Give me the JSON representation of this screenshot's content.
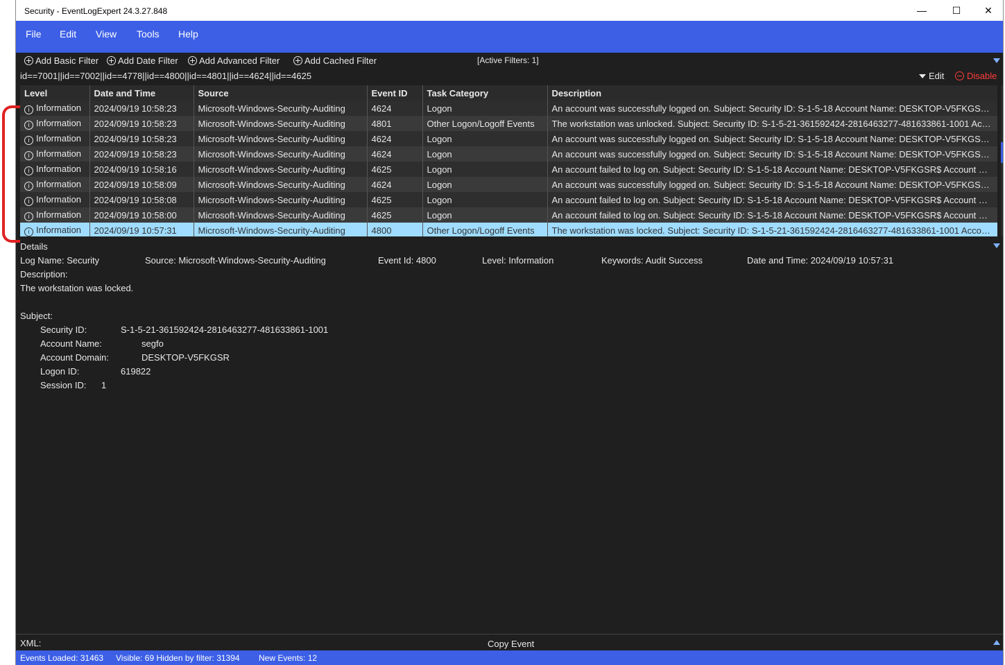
{
  "window": {
    "title": "Security - EventLogExpert 24.3.27.848"
  },
  "window_controls": {
    "minimize": "—",
    "maximize": "☐",
    "close": "✕"
  },
  "menu": [
    "File",
    "Edit",
    "View",
    "Tools",
    "Help"
  ],
  "filters": {
    "buttons": [
      "Add Basic Filter",
      "Add Date Filter",
      "Add Advanced Filter",
      "Add Cached Filter"
    ],
    "active_label": "[Active Filters: 1]",
    "expression": "id==7001||id==7002||id==4778||id==4800||id==4801||id==4624||id==4625",
    "edit_label": "Edit",
    "disable_label": "Disable"
  },
  "table": {
    "columns": [
      "Level",
      "Date and Time",
      "Source",
      "Event ID",
      "Task Category",
      "Description"
    ],
    "rows": [
      [
        "Information",
        "2024/09/19 10:58:23",
        "Microsoft-Windows-Security-Auditing",
        "4624",
        "Logon",
        "An account was successfully logged on. Subject: Security ID: S-1-5-18 Account Name: DESKTOP-V5FKGSR$ ..."
      ],
      [
        "Information",
        "2024/09/19 10:58:23",
        "Microsoft-Windows-Security-Auditing",
        "4801",
        "Other Logon/Logoff Events",
        "The workstation was unlocked. Subject: Security ID: S-1-5-21-361592424-2816463277-481633861-1001 Acc..."
      ],
      [
        "Information",
        "2024/09/19 10:58:23",
        "Microsoft-Windows-Security-Auditing",
        "4624",
        "Logon",
        "An account was successfully logged on. Subject: Security ID: S-1-5-18 Account Name: DESKTOP-V5FKGSR$ ..."
      ],
      [
        "Information",
        "2024/09/19 10:58:23",
        "Microsoft-Windows-Security-Auditing",
        "4624",
        "Logon",
        "An account was successfully logged on. Subject: Security ID: S-1-5-18 Account Name: DESKTOP-V5FKGSR$ ..."
      ],
      [
        "Information",
        "2024/09/19 10:58:16",
        "Microsoft-Windows-Security-Auditing",
        "4625",
        "Logon",
        "An account failed to log on. Subject: Security ID: S-1-5-18 Account Name: DESKTOP-V5FKGSR$ Account Do..."
      ],
      [
        "Information",
        "2024/09/19 10:58:09",
        "Microsoft-Windows-Security-Auditing",
        "4624",
        "Logon",
        "An account was successfully logged on. Subject: Security ID: S-1-5-18 Account Name: DESKTOP-V5FKGSR$ ..."
      ],
      [
        "Information",
        "2024/09/19 10:58:08",
        "Microsoft-Windows-Security-Auditing",
        "4625",
        "Logon",
        "An account failed to log on. Subject: Security ID: S-1-5-18 Account Name: DESKTOP-V5FKGSR$ Account Do..."
      ],
      [
        "Information",
        "2024/09/19 10:58:00",
        "Microsoft-Windows-Security-Auditing",
        "4625",
        "Logon",
        "An account failed to log on. Subject: Security ID: S-1-5-18 Account Name: DESKTOP-V5FKGSR$ Account Do..."
      ],
      [
        "Information",
        "2024/09/19 10:57:31",
        "Microsoft-Windows-Security-Auditing",
        "4800",
        "Other Logon/Logoff Events",
        "The workstation was locked. Subject: Security ID: S-1-5-21-361592424-2816463277-481633861-1001 Accou..."
      ]
    ],
    "selected_index": 8
  },
  "details": {
    "header": "Details",
    "fields": [
      "Log Name: Security",
      "Source: Microsoft-Windows-Security-Auditing",
      "Event Id: 4800",
      "Level: Information",
      "Keywords: Audit Success",
      "Date and Time: 2024/09/19 10:57:31"
    ],
    "description_label": "Description:",
    "description_text": "The workstation was locked.",
    "subject_label": "Subject:",
    "subject": [
      {
        "label": "Security ID:",
        "value": "S-1-5-21-361592424-2816463277-481633861-1001"
      },
      {
        "label": "Account Name:",
        "value": "segfo"
      },
      {
        "label": "Account Domain:",
        "value": "DESKTOP-V5FKGSR"
      },
      {
        "label": "Logon ID:",
        "value": "619822"
      },
      {
        "label": "Session ID:",
        "value": "1"
      }
    ]
  },
  "xml": {
    "label": "XML:",
    "copy_label": "Copy Event"
  },
  "status": {
    "loaded": "Events Loaded: 31463",
    "visible": "Visible: 69 Hidden by filter: 31394",
    "new_events": "New Events: 12"
  },
  "colors": {
    "accent": "#3c5fe6",
    "selected_row": "#9fdcff",
    "disable": "#ff3b3b",
    "annotation": "#e02020"
  }
}
